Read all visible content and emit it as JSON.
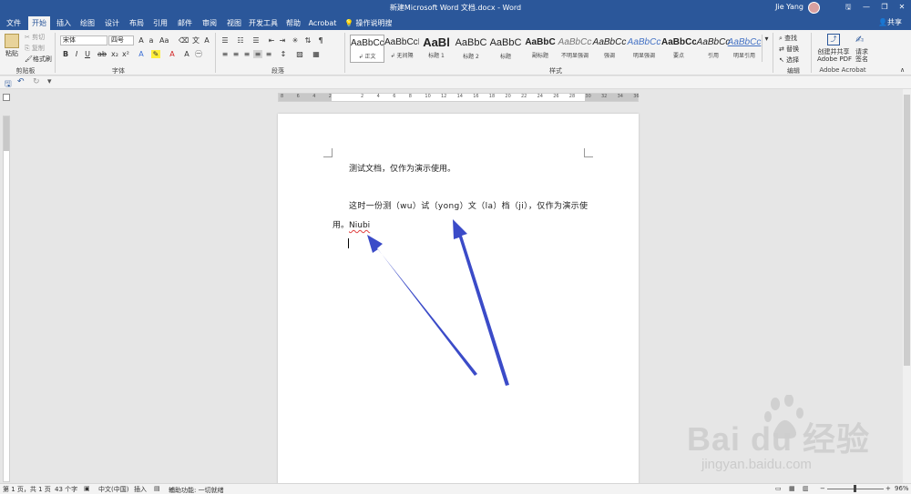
{
  "window": {
    "title": "新建Microsoft Word 文档.docx - Word",
    "user": "Jie Yang",
    "buttons": [
      "🖫",
      "—",
      "❐",
      "✕"
    ]
  },
  "tabs": [
    {
      "label": "文件",
      "active": false
    },
    {
      "label": "开始",
      "active": true
    },
    {
      "label": "插入",
      "active": false
    },
    {
      "label": "绘图",
      "active": false
    },
    {
      "label": "设计",
      "active": false
    },
    {
      "label": "布局",
      "active": false
    },
    {
      "label": "引用",
      "active": false
    },
    {
      "label": "邮件",
      "active": false
    },
    {
      "label": "审阅",
      "active": false
    },
    {
      "label": "视图",
      "active": false
    },
    {
      "label": "开发工具",
      "active": false
    },
    {
      "label": "帮助",
      "active": false
    },
    {
      "label": "Acrobat",
      "active": false
    }
  ],
  "tell_me": "操作说明搜索",
  "share": "共享",
  "ribbon": {
    "clipboard": {
      "paste": "粘贴",
      "cut": "剪切",
      "copy": "复制",
      "format_painter": "格式刷",
      "label": "剪贴板"
    },
    "font": {
      "font_name": "宋体",
      "font_size": "四号",
      "label": "字体"
    },
    "paragraph": {
      "label": "段落"
    },
    "styles": {
      "label": "样式",
      "items": [
        {
          "sample": "AaBbCcI",
          "name": "↲ 正文"
        },
        {
          "sample": "AaBbCcI",
          "name": "↲ 无间隔"
        },
        {
          "sample": "AaBl",
          "name": "标题 1"
        },
        {
          "sample": "AaBbC",
          "name": "标题 2"
        },
        {
          "sample": "AaBbC",
          "name": "标题"
        },
        {
          "sample": "AaBbC",
          "name": "副标题"
        },
        {
          "sample": "AaBbCc",
          "name": "不明显强调"
        },
        {
          "sample": "AaBbCc",
          "name": "强调"
        },
        {
          "sample": "AaBbCc",
          "name": "明显强调"
        },
        {
          "sample": "AaBbCc",
          "name": "要点"
        },
        {
          "sample": "AaBbCc",
          "name": "引用"
        },
        {
          "sample": "AaBbCc",
          "name": "明显引用"
        }
      ]
    },
    "editing": {
      "find": "查找",
      "replace": "替换",
      "select": "选择",
      "label": "编辑"
    },
    "acrobat": {
      "create_share_line1": "创建并共享",
      "create_share_line2": "Adobe PDF",
      "request_sign_line1": "请求",
      "request_sign_line2": "签名",
      "label": "Adobe Acrobat"
    }
  },
  "document": {
    "line1": "测试文档，仅作为演示使用。",
    "line2": "这时一份测（wu）试（yong）文（la）档（ji），仅作为演示使",
    "line3_prefix": "用。",
    "line3_word": "Niubi",
    "ruler_numbers": [
      "8",
      "6",
      "4",
      "2",
      "",
      "2",
      "4",
      "6",
      "8",
      "10",
      "12",
      "14",
      "16",
      "18",
      "20",
      "22",
      "24",
      "26",
      "28",
      "30",
      "32",
      "34",
      "36"
    ]
  },
  "status": {
    "page": "第 1 页，共 1 页",
    "words": "43 个字",
    "language": "中文(中国)",
    "mode": "插入",
    "accessibility": "辅助功能: 一切就绪",
    "zoom": "96%"
  },
  "watermark": {
    "brand": "Bai du 经验",
    "site": "jingyan.baidu.com"
  },
  "colors": {
    "accent": "#2b579a",
    "arrow": "#3b4bc8"
  }
}
